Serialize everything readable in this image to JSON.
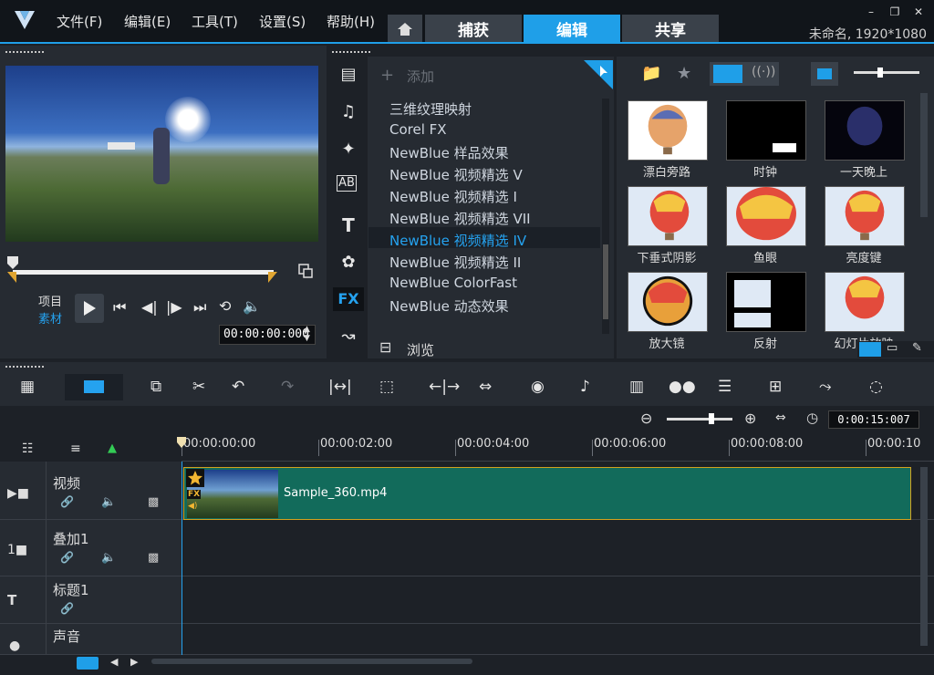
{
  "menu": {
    "file": "文件(F)",
    "edit": "编辑(E)",
    "tools": "工具(T)",
    "settings": "设置(S)",
    "help": "帮助(H)"
  },
  "tabs": {
    "capture": "捕获",
    "edit": "编辑",
    "share": "共享"
  },
  "project_title": "未命名, 1920*1080",
  "player": {
    "mode_project": "项目",
    "mode_clip": "素材",
    "timecode": "00:00:00:000"
  },
  "library": {
    "add_label": "添加",
    "browse_label": "浏览",
    "fx_items": [
      "三维纹理映射",
      "Corel FX",
      "NewBlue 样品效果",
      "NewBlue 视频精选 V",
      "NewBlue 视频精选 I",
      "NewBlue 视频精选 VII",
      "NewBlue 视频精选 IV",
      "NewBlue 视频精选 II",
      "NewBlue ColorFast",
      "NewBlue 动态效果"
    ],
    "selected_index": 6,
    "thumbs": [
      "漂白旁路",
      "时钟",
      "一天晚上",
      "下垂式阴影",
      "鱼眼",
      "亮度键",
      "放大镜",
      "反射",
      "幻灯片放映"
    ]
  },
  "timeline": {
    "zoom_timecode": "0:00:15:007",
    "ruler_labels": [
      "00:00:00:00",
      "00:00:02:00",
      "00:00:04:00",
      "00:00:06:00",
      "00:00:08:00",
      "00:00:10"
    ],
    "tracks": {
      "video": "视频",
      "overlay": "叠加1",
      "title": "标题1",
      "voice": "声音"
    },
    "clip_name": "Sample_360.mp4",
    "clip_fx_badge": "FX"
  },
  "colors": {
    "accent": "#1f9fe8",
    "clip": "#126b5b",
    "clip_border": "#d3a21f"
  }
}
